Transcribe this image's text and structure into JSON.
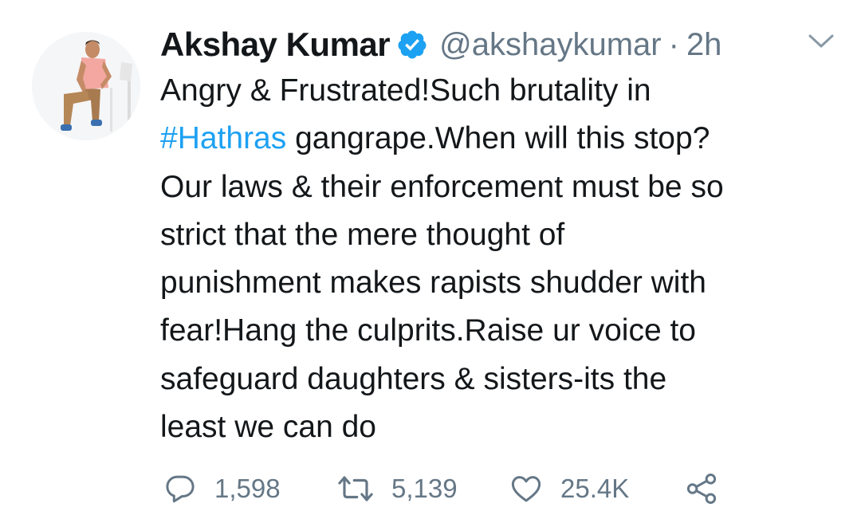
{
  "colors": {
    "text": "#14171a",
    "muted": "#657786",
    "link": "#1da1f2",
    "verified": "#1da1f2"
  },
  "tweet": {
    "author_name": "Akshay Kumar",
    "verified_icon": "verified-badge-icon",
    "handle": "@akshaykumar",
    "separator": "·",
    "time": "2h",
    "menu_icon": "chevron-down-icon",
    "text_lines": {
      "l1": "Angry & Frustrated!Such brutality in",
      "l2_hashtag": "#Hathras",
      "l2_rest": " gangrape.When will this stop?",
      "l3": "Our laws & their enforcement must be so",
      "l4": "strict that the mere thought of",
      "l5": "punishment makes rapists shudder with",
      "l6": "fear!Hang the culprits.Raise ur voice to",
      "l7": "safeguard daughters & sisters-its the",
      "l8": "least we can do"
    }
  },
  "actions": {
    "reply": {
      "icon": "reply-icon",
      "count": "1,598"
    },
    "retweet": {
      "icon": "retweet-icon",
      "count": "5,139"
    },
    "like": {
      "icon": "heart-icon",
      "count": "25.4K"
    },
    "share": {
      "icon": "share-icon"
    }
  }
}
